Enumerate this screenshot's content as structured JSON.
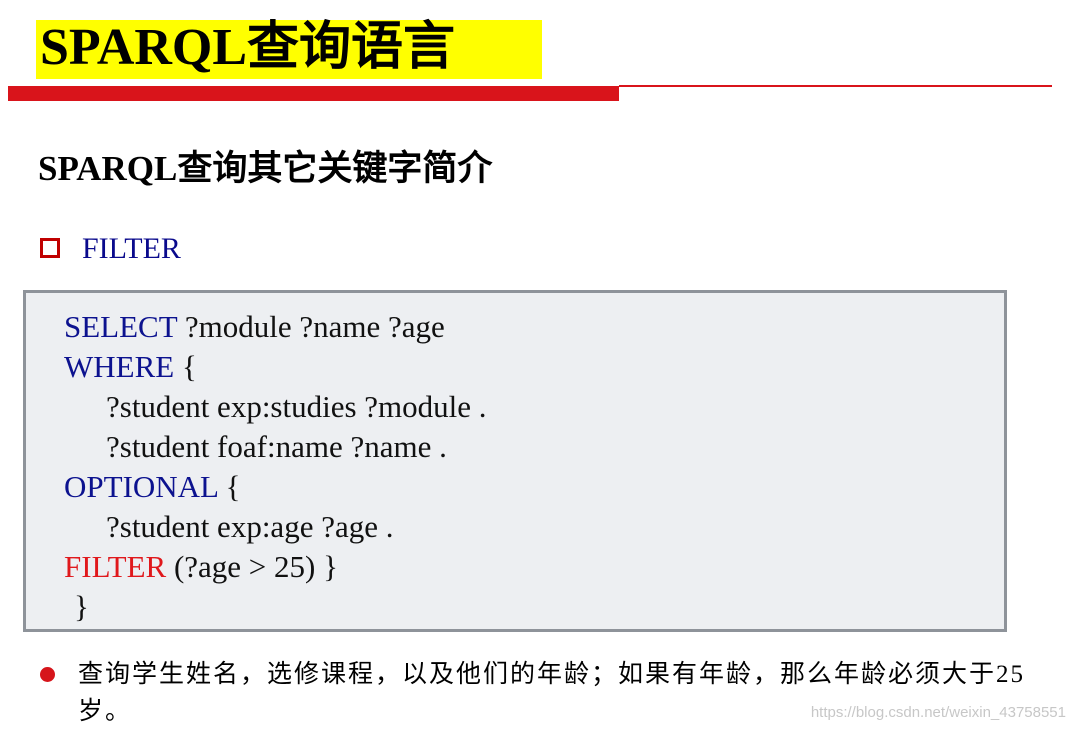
{
  "slide": {
    "title": "SPARQL查询语言",
    "subtitle": "SPARQL查询其它关键字简介",
    "section_label": "FILTER",
    "code": [
      {
        "kw": "SELECT",
        "rest": " ?module ?name ?age"
      },
      {
        "kw": "WHERE",
        "rest": " {"
      },
      {
        "kw": "",
        "rest": "?student exp:studies ?module ."
      },
      {
        "kw": "",
        "rest": "?student foaf:name ?name ."
      },
      {
        "kw": "OPTIONAL",
        "rest": " {"
      },
      {
        "kw": "",
        "rest": "?student exp:age ?age ."
      },
      {
        "kw": "FILTER",
        "rest": " (?age > 25) }"
      },
      {
        "kw": "",
        "rest": "}"
      }
    ],
    "note": "查询学生姓名，选修课程，以及他们的年龄；如果有年龄，那么年龄必须大于25岁。",
    "watermark": "https://blog.csdn.net/weixin_43758551"
  },
  "colors": {
    "title_highlight": "#ffff00",
    "rule_red": "#d9141b",
    "keyword_blue": "#0c128f",
    "filter_red": "#e0181c",
    "code_bg": "#edeff2",
    "code_border": "#8e939a"
  },
  "icons": {
    "section_bullet": "hollow-red-square-icon",
    "note_bullet": "red-dot-icon"
  }
}
